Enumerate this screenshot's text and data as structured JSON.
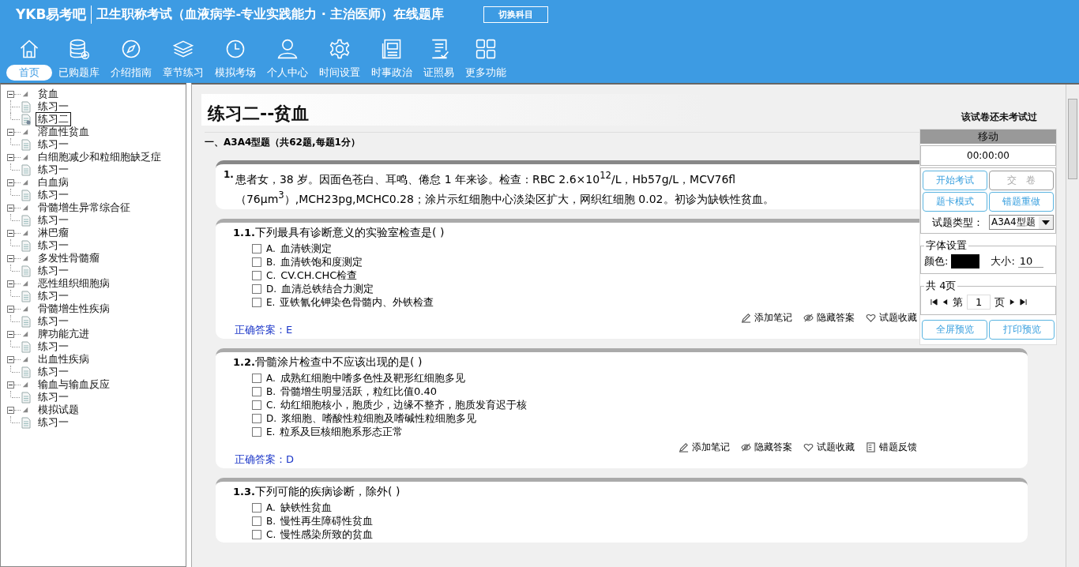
{
  "header": {
    "logo": "YKB易考吧",
    "title": "卫生职称考试（血液病学-专业实践能力 · 主治医师）在线题库",
    "switch_button": "切换科目"
  },
  "nav": [
    {
      "label": "首页",
      "selected": true
    },
    {
      "label": "已购题库",
      "selected": false
    },
    {
      "label": "介绍指南",
      "selected": false
    },
    {
      "label": "章节练习",
      "selected": false
    },
    {
      "label": "模拟考场",
      "selected": false
    },
    {
      "label": "个人中心",
      "selected": false
    },
    {
      "label": "时间设置",
      "selected": false
    },
    {
      "label": "时事政治",
      "selected": false
    },
    {
      "label": "证照易",
      "selected": false
    },
    {
      "label": "更多功能",
      "selected": false
    }
  ],
  "tree": [
    {
      "label": "贫血",
      "expanded": true,
      "children": [
        {
          "label": "练习一",
          "selected": false
        },
        {
          "label": "练习二",
          "selected": true
        }
      ]
    },
    {
      "label": "溶血性贫血",
      "expanded": true,
      "children": [
        {
          "label": "练习一",
          "selected": false
        }
      ]
    },
    {
      "label": "白细胞减少和粒细胞缺乏症",
      "expanded": true,
      "children": [
        {
          "label": "练习一",
          "selected": false
        }
      ]
    },
    {
      "label": "白血病",
      "expanded": true,
      "children": [
        {
          "label": "练习一",
          "selected": false
        }
      ]
    },
    {
      "label": "骨髓增生异常综合征",
      "expanded": true,
      "children": [
        {
          "label": "练习一",
          "selected": false
        }
      ]
    },
    {
      "label": "淋巴瘤",
      "expanded": true,
      "children": [
        {
          "label": "练习一",
          "selected": false
        }
      ]
    },
    {
      "label": "多发性骨髓瘤",
      "expanded": true,
      "children": [
        {
          "label": "练习一",
          "selected": false
        }
      ]
    },
    {
      "label": "恶性组织细胞病",
      "expanded": true,
      "children": [
        {
          "label": "练习一",
          "selected": false
        }
      ]
    },
    {
      "label": "骨髓增生性疾病",
      "expanded": true,
      "children": [
        {
          "label": "练习一",
          "selected": false
        }
      ]
    },
    {
      "label": "脾功能亢进",
      "expanded": true,
      "children": [
        {
          "label": "练习一",
          "selected": false
        }
      ]
    },
    {
      "label": "出血性疾病",
      "expanded": true,
      "children": [
        {
          "label": "练习一",
          "selected": false
        }
      ]
    },
    {
      "label": "输血与输血反应",
      "expanded": true,
      "children": [
        {
          "label": "练习一",
          "selected": false
        }
      ]
    },
    {
      "label": "模拟试题",
      "expanded": true,
      "children": [
        {
          "label": "练习一",
          "selected": false
        }
      ]
    }
  ],
  "paper": {
    "title": "练习二--贫血",
    "status": "该试卷还未考试过",
    "section": "一、A3A4型题（共62题,每题1分）"
  },
  "case": {
    "number": "1.",
    "text": "患者女，38 岁。因面色苍白、耳鸣、倦怠 1 年来诊。检查：RBC 2.6×10$^{12}$/L，Hb57g/L，MCV76fl（76μm$^{3}$）,MCH23pg,MCHC0.28；涂片示红细胞中心淡染区扩大，网织红细胞 0.02。初诊为缺铁性贫血。"
  },
  "questions": [
    {
      "number": "1.1.",
      "stem": "下列最具有诊断意义的实验室检查是( )",
      "options": [
        {
          "letter": "A.",
          "text": "血清铁测定",
          "checked": false
        },
        {
          "letter": "B.",
          "text": "血清铁饱和度测定",
          "checked": false
        },
        {
          "letter": "C.",
          "text": "CV.CH.CHC检查",
          "checked": false
        },
        {
          "letter": "D.",
          "text": "血清总铁结合力测定",
          "checked": false
        },
        {
          "letter": "E.",
          "text": "亚铁氰化钾染色骨髓内、外铁检查",
          "checked": false
        }
      ],
      "actions": [
        {
          "kind": "note",
          "label": "添加笔记"
        },
        {
          "kind": "hide",
          "label": "隐藏答案"
        },
        {
          "kind": "favorite",
          "label": "试题收藏"
        }
      ],
      "answer": "正确答案：E"
    },
    {
      "number": "1.2.",
      "stem": "骨髓涂片检查中不应该出现的是( )",
      "options": [
        {
          "letter": "A.",
          "text": "成熟红细胞中嗜多色性及靶形红细胞多见",
          "checked": false
        },
        {
          "letter": "B.",
          "text": "骨髓增生明显活跃，粒红比值0.40",
          "checked": false
        },
        {
          "letter": "C.",
          "text": "幼红细胞核小，胞质少，边缘不整齐，胞质发育迟于核",
          "checked": false
        },
        {
          "letter": "D.",
          "text": "浆细胞、嗜酸性粒细胞及嗜碱性粒细胞多见",
          "checked": false
        },
        {
          "letter": "E.",
          "text": "粒系及巨核细胞系形态正常",
          "checked": false
        }
      ],
      "actions": [
        {
          "kind": "note",
          "label": "添加笔记"
        },
        {
          "kind": "hide",
          "label": "隐藏答案"
        },
        {
          "kind": "favorite",
          "label": "试题收藏"
        },
        {
          "kind": "report",
          "label": "错题反馈"
        }
      ],
      "answer": "正确答案：D"
    },
    {
      "number": "1.3.",
      "stem": "下列可能的疾病诊断，除外( )",
      "options": [
        {
          "letter": "A.",
          "text": "缺铁性贫血",
          "checked": false
        },
        {
          "letter": "B.",
          "text": "慢性再生障碍性贫血",
          "checked": false
        },
        {
          "letter": "C.",
          "text": "慢性感染所致的贫血",
          "checked": false
        }
      ]
    }
  ],
  "panel": {
    "header": "移动",
    "timer": "00:00:00",
    "buttons": [
      {
        "label": "开始考试",
        "disabled": false
      },
      {
        "label": "交　卷",
        "disabled": true
      },
      {
        "label": "题卡模式",
        "disabled": false
      },
      {
        "label": "错题重做",
        "disabled": false
      }
    ],
    "type_label": "试题类型：",
    "type_value": "A3A4型题",
    "font_legend": "字体设置",
    "color_label": "颜色:",
    "size_label": "大小:",
    "size_value": "10",
    "pages_legend": "共 4页",
    "page_prefix": "第",
    "page_value": "1",
    "page_suffix": "页",
    "bottom_buttons": [
      "全屏预览",
      "打印预览"
    ]
  }
}
